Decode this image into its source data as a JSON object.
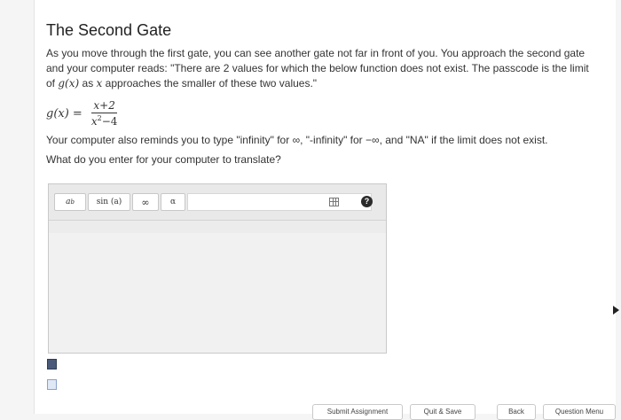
{
  "page": {
    "title": "The Second Gate",
    "paragraph": "As you move through the first gate, you can see another gate not far in front of you. You approach the second gate and your computer reads: \"There are 2 values for which the below function does not exist. The passcode is the limit of",
    "paragraph_mid": "as",
    "paragraph_end": "approaches the smaller of these two values.\"",
    "gx": "g(x)",
    "x": "x",
    "formula": {
      "lhs": "g(x) =",
      "numerator": "x+2",
      "denominator_base": "x",
      "denominator_exp": "2",
      "denominator_rest": "−4"
    },
    "reminder": {
      "part1": "Your computer also reminds you to type \"infinity\" for",
      "inf": "∞",
      "part2": ", \"-infinity\" for",
      "neginf": "−∞",
      "part3": ", and \"NA\" if the limit does not exist."
    },
    "question": "What do you enter for your computer to translate?"
  },
  "editor": {
    "toolbar": {
      "power_base": "a",
      "power_exp": "b",
      "sin_label": "sin (a)",
      "infinity_label": "∞",
      "alpha_label": "α",
      "table_icon": "table-icon",
      "help_label": "?"
    },
    "answer_value": ""
  },
  "footer": {
    "submit_label": "Submit Assignment",
    "quit_label": "Quit & Save",
    "back_label": "Back",
    "menu_label": "Question Menu"
  }
}
